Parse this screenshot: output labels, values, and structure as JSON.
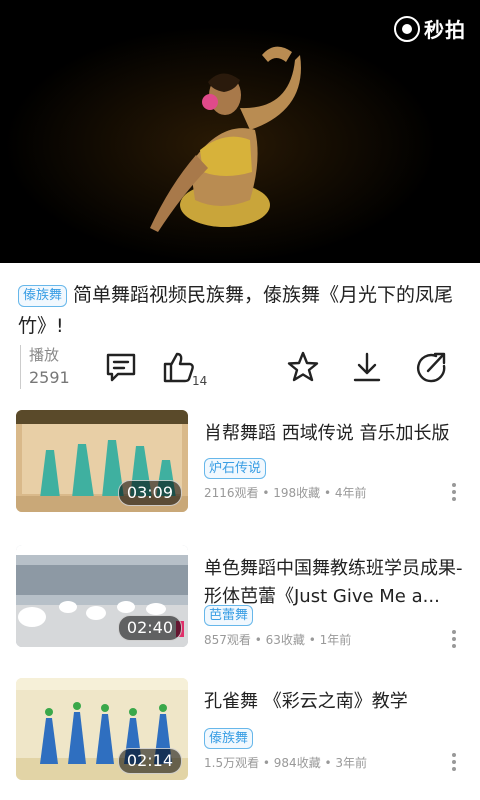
{
  "player": {
    "watermark_text": "秒拍"
  },
  "video": {
    "tag": "傣族舞",
    "title": "简单舞蹈视频民族舞，傣族舞《月光下的凤尾竹》!",
    "play_label": "播放",
    "play_count": "2591",
    "like_count": "14",
    "actions": [
      "comment-icon",
      "like-icon",
      "favorite-star-icon",
      "download-icon",
      "share-icon"
    ]
  },
  "related": [
    {
      "title": "肖帮舞蹈 西域传说 音乐加长版",
      "tag": "炉石传说",
      "meta": "2116观看 • 198收藏 • 4年前",
      "duration": "03:09"
    },
    {
      "title": "单色舞蹈中国舞教练班学员成果-形体芭蕾《Just Give Me a...",
      "tag": "芭蕾舞",
      "meta": "857观看 • 63收藏 • 1年前",
      "duration": "02:40"
    },
    {
      "title": "孔雀舞 《彩云之南》教学",
      "tag": "傣族舞",
      "meta": "1.5万观看 • 984收藏 • 3年前",
      "duration": "02:14"
    }
  ],
  "colors": {
    "accent": "#3a9ee4",
    "tag_bg": "#f1f8fe",
    "meta": "#999999"
  }
}
